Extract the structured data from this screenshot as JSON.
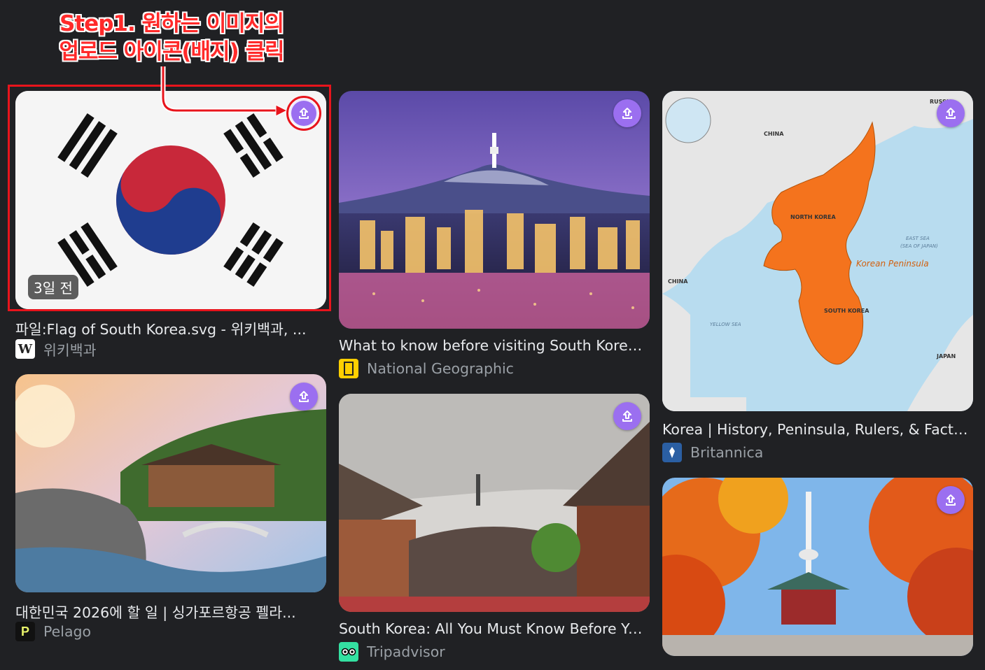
{
  "annotation": {
    "line1": "Step1. 원하는 이미지의",
    "line2": "업로드 아이콘(배지) 클릭",
    "color": "#e8141c"
  },
  "results": [
    {
      "title": "파일:Flag of South Korea.svg - 위키백과, ...",
      "source": "위키백과",
      "badge": "3일 전",
      "source_icon": "W"
    },
    {
      "title": "What to know before visiting South Korea: ...",
      "source": "National Geographic",
      "source_icon": "natgeo-frame"
    },
    {
      "title": "Korea | History, Peninsula, Rulers, & Facts ...",
      "source": "Britannica",
      "source_icon": "britannica-thistle"
    },
    {
      "title": "대한민국 2026에 할 일 | 싱가포르항공 펠라...",
      "source": "Pelago",
      "source_icon": "P"
    },
    {
      "title": "South Korea: All You Must Know Before Yo...",
      "source": "Tripadvisor",
      "source_icon": "owl-eyes"
    }
  ],
  "map_labels": {
    "russia": "RUSSIA",
    "china_top": "CHINA",
    "china_left": "CHINA",
    "north_korea": "NORTH KOREA",
    "south_korea": "SOUTH KOREA",
    "peninsula": "Korean Peninsula",
    "east_sea": "EAST SEA",
    "sea_of_japan": "(SEA OF JAPAN)",
    "yellow_sea": "YELLOW SEA",
    "japan": "JAPAN"
  },
  "accent": "#9b6ff0"
}
